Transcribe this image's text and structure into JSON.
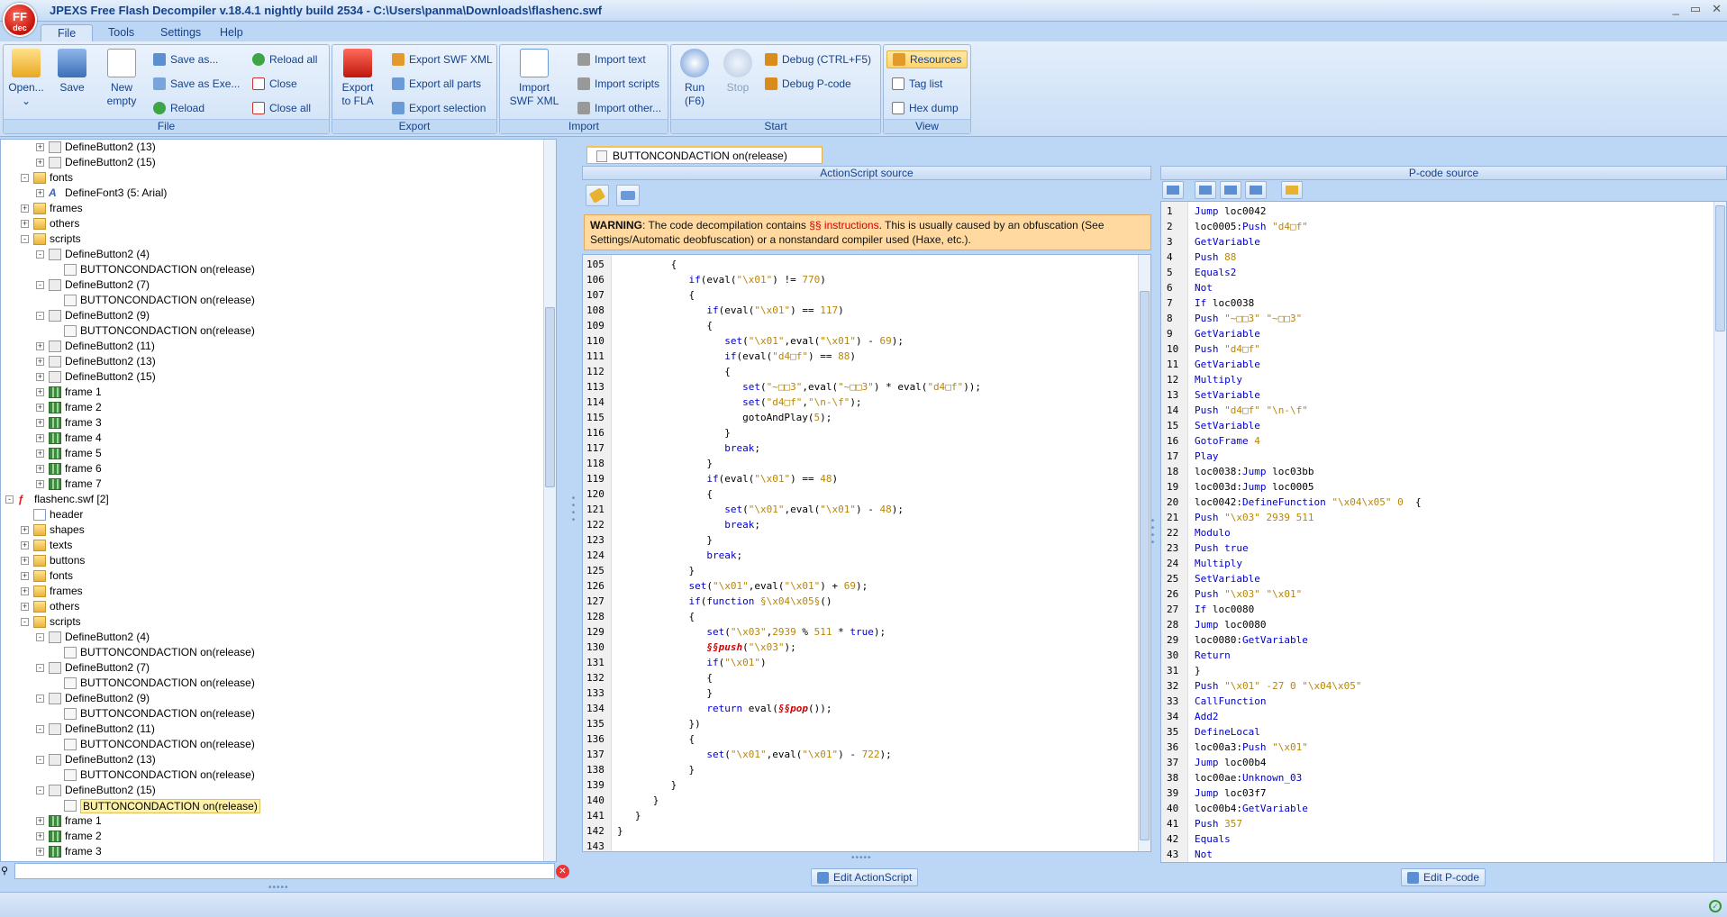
{
  "window": {
    "title": "JPEXS Free Flash Decompiler v.18.4.1 nightly build 2534 - C:\\Users\\panma\\Downloads\\flashenc.swf",
    "logo_top": "FF",
    "logo_bottom": "dec",
    "controls": [
      "_",
      "▭",
      "✕"
    ]
  },
  "menu_tabs": [
    "File",
    "Tools",
    "Settings",
    "Help"
  ],
  "ribbon": {
    "file": {
      "title": "File",
      "open": "Open...",
      "open_arrow": "⌄",
      "save": "Save",
      "new": "New",
      "new2": "empty",
      "save_as": "Save as...",
      "save_as_exe": "Save as Exe...",
      "reload": "Reload",
      "reload_all": "Reload all",
      "close": "Close",
      "close_all": "Close all"
    },
    "export": {
      "title": "Export",
      "export_fla": "Export",
      "export_fla2": "to FLA",
      "export_swf_xml": "Export SWF XML",
      "export_all_parts": "Export all parts",
      "export_selection": "Export selection"
    },
    "import": {
      "title": "Import",
      "import_swf_xml": "Import",
      "import_swf_xml2": "SWF XML",
      "import_text": "Import text",
      "import_scripts": "Import scripts",
      "import_other": "Import other..."
    },
    "start": {
      "title": "Start",
      "run": "Run",
      "run2": "(F6)",
      "stop": "Stop",
      "debug": "Debug (CTRL+F5)",
      "debug_pcode": "Debug P-code"
    },
    "view": {
      "title": "View",
      "resources": "Resources",
      "tag_list": "Tag list",
      "hex_dump": "Hex dump"
    }
  },
  "tree": [
    {
      "d": 1,
      "t": "DefineButton2 (13)",
      "i": "button",
      "e": "+"
    },
    {
      "d": 1,
      "t": "DefineButton2 (15)",
      "i": "button",
      "e": "+"
    },
    {
      "d": 0,
      "t": "fonts",
      "i": "folder",
      "e": "-"
    },
    {
      "d": 1,
      "t": "DefineFont3 (5: Arial)",
      "i": "font",
      "e": "+"
    },
    {
      "d": 0,
      "t": "frames",
      "i": "folder",
      "e": "+"
    },
    {
      "d": 0,
      "t": "others",
      "i": "folder",
      "e": "+"
    },
    {
      "d": 0,
      "t": "scripts",
      "i": "folder",
      "e": "-"
    },
    {
      "d": 1,
      "t": "DefineButton2 (4)",
      "i": "button",
      "e": "-"
    },
    {
      "d": 2,
      "t": "BUTTONCONDACTION on(release)",
      "i": "script",
      "e": ""
    },
    {
      "d": 1,
      "t": "DefineButton2 (7)",
      "i": "button",
      "e": "-"
    },
    {
      "d": 2,
      "t": "BUTTONCONDACTION on(release)",
      "i": "script",
      "e": ""
    },
    {
      "d": 1,
      "t": "DefineButton2 (9)",
      "i": "button",
      "e": "-"
    },
    {
      "d": 2,
      "t": "BUTTONCONDACTION on(release)",
      "i": "script",
      "e": ""
    },
    {
      "d": 1,
      "t": "DefineButton2 (11)",
      "i": "button",
      "e": "+"
    },
    {
      "d": 1,
      "t": "DefineButton2 (13)",
      "i": "button",
      "e": "+"
    },
    {
      "d": 1,
      "t": "DefineButton2 (15)",
      "i": "button",
      "e": "+"
    },
    {
      "d": 1,
      "t": "frame 1",
      "i": "frame",
      "e": "+"
    },
    {
      "d": 1,
      "t": "frame 2",
      "i": "frame",
      "e": "+"
    },
    {
      "d": 1,
      "t": "frame 3",
      "i": "frame",
      "e": "+"
    },
    {
      "d": 1,
      "t": "frame 4",
      "i": "frame",
      "e": "+"
    },
    {
      "d": 1,
      "t": "frame 5",
      "i": "frame",
      "e": "+"
    },
    {
      "d": 1,
      "t": "frame 6",
      "i": "frame",
      "e": "+"
    },
    {
      "d": 1,
      "t": "frame 7",
      "i": "frame",
      "e": "+"
    },
    {
      "d": -1,
      "t": "flashenc.swf [2]",
      "i": "swf",
      "e": "-"
    },
    {
      "d": 0,
      "t": "header",
      "i": "header",
      "e": ""
    },
    {
      "d": 0,
      "t": "shapes",
      "i": "folder",
      "e": "+"
    },
    {
      "d": 0,
      "t": "texts",
      "i": "folder",
      "e": "+"
    },
    {
      "d": 0,
      "t": "buttons",
      "i": "folder",
      "e": "+"
    },
    {
      "d": 0,
      "t": "fonts",
      "i": "folder",
      "e": "+"
    },
    {
      "d": 0,
      "t": "frames",
      "i": "folder",
      "e": "+"
    },
    {
      "d": 0,
      "t": "others",
      "i": "folder",
      "e": "+"
    },
    {
      "d": 0,
      "t": "scripts",
      "i": "folder",
      "e": "-"
    },
    {
      "d": 1,
      "t": "DefineButton2 (4)",
      "i": "button",
      "e": "-"
    },
    {
      "d": 2,
      "t": "BUTTONCONDACTION on(release)",
      "i": "script",
      "e": ""
    },
    {
      "d": 1,
      "t": "DefineButton2 (7)",
      "i": "button",
      "e": "-"
    },
    {
      "d": 2,
      "t": "BUTTONCONDACTION on(release)",
      "i": "script",
      "e": ""
    },
    {
      "d": 1,
      "t": "DefineButton2 (9)",
      "i": "button",
      "e": "-"
    },
    {
      "d": 2,
      "t": "BUTTONCONDACTION on(release)",
      "i": "script",
      "e": ""
    },
    {
      "d": 1,
      "t": "DefineButton2 (11)",
      "i": "button",
      "e": "-"
    },
    {
      "d": 2,
      "t": "BUTTONCONDACTION on(release)",
      "i": "script",
      "e": ""
    },
    {
      "d": 1,
      "t": "DefineButton2 (13)",
      "i": "button",
      "e": "-"
    },
    {
      "d": 2,
      "t": "BUTTONCONDACTION on(release)",
      "i": "script",
      "e": ""
    },
    {
      "d": 1,
      "t": "DefineButton2 (15)",
      "i": "button",
      "e": "-"
    },
    {
      "d": 2,
      "t": "BUTTONCONDACTION on(release)",
      "i": "script",
      "e": "",
      "sel": true
    },
    {
      "d": 1,
      "t": "frame 1",
      "i": "frame",
      "e": "+"
    },
    {
      "d": 1,
      "t": "frame 2",
      "i": "frame",
      "e": "+"
    },
    {
      "d": 1,
      "t": "frame 3",
      "i": "frame",
      "e": "+"
    }
  ],
  "search": {
    "value": "",
    "placeholder": ""
  },
  "doc_tab": "BUTTONCONDACTION on(release)",
  "as_header": "ActionScript source",
  "pcode_header": "P-code source",
  "warning": {
    "bold": "WARNING",
    "p1": ": The code decompilation contains ",
    "red": "§§ instructions",
    "p2": ". This is usually caused by an obfuscation (See",
    "line2": "Settings/Automatic deobfuscation) or a nonstandard compiler used (Haxe, etc.)."
  },
  "as_code": [
    {
      "n": "105",
      "c": "         {"
    },
    {
      "n": "106",
      "c": "            <k>if</k>(eval(<s>\"\\x01\"</s>) != <s>770</s>)"
    },
    {
      "n": "107",
      "c": "            {"
    },
    {
      "n": "108",
      "c": "               <k>if</k>(eval(<s>\"\\x01\"</s>) == <s>117</s>)"
    },
    {
      "n": "109",
      "c": "               {"
    },
    {
      "n": "110",
      "c": "                  <k>set</k>(<s>\"\\x01\"</s>,eval(<s>\"\\x01\"</s>) - <s>69</s>);"
    },
    {
      "n": "111",
      "c": "                  <k>if</k>(eval(<s>\"d4□f\"</s>) == <s>88</s>)"
    },
    {
      "n": "112",
      "c": "                  {"
    },
    {
      "n": "113",
      "c": "                     <k>set</k>(<s>\"~□□3\"</s>,eval(<s>\"~□□3\"</s>) * eval(<s>\"d4□f\"</s>));"
    },
    {
      "n": "114",
      "c": "                     <k>set</k>(<s>\"d4□f\"</s>,<s>\"\\n-\\f\"</s>);"
    },
    {
      "n": "115",
      "c": "                     gotoAndPlay(<s>5</s>);"
    },
    {
      "n": "116",
      "c": "                  }"
    },
    {
      "n": "117",
      "c": "                  <k>break</k>;"
    },
    {
      "n": "118",
      "c": "               }"
    },
    {
      "n": "119",
      "c": "               <k>if</k>(eval(<s>\"\\x01\"</s>) == <s>48</s>)"
    },
    {
      "n": "120",
      "c": "               {"
    },
    {
      "n": "121",
      "c": "                  <k>set</k>(<s>\"\\x01\"</s>,eval(<s>\"\\x01\"</s>) - <s>48</s>);"
    },
    {
      "n": "122",
      "c": "                  <k>break</k>;"
    },
    {
      "n": "123",
      "c": "               }"
    },
    {
      "n": "124",
      "c": "               <k>break</k>;"
    },
    {
      "n": "125",
      "c": "            }"
    },
    {
      "n": "126",
      "c": "            <k>set</k>(<s>\"\\x01\"</s>,eval(<s>\"\\x01\"</s>) + <s>69</s>);"
    },
    {
      "n": "127",
      "c": "            <k>if</k>(<k>function</k> <s>§\\x04\\x05§</s>()"
    },
    {
      "n": "128",
      "c": "            {"
    },
    {
      "n": "129",
      "c": "               <k>set</k>(<s>\"\\x03\"</s>,<s>2939</s> % <s>511</s> * <k>true</k>);"
    },
    {
      "n": "130",
      "c": "               <r>§§push</r>(<s>\"\\x03\"</s>);"
    },
    {
      "n": "131",
      "c": "               <k>if</k>(<s>\"\\x01\"</s>)"
    },
    {
      "n": "132",
      "c": "               {"
    },
    {
      "n": "133",
      "c": "               }"
    },
    {
      "n": "134",
      "c": "               <k>return</k> eval(<r>§§pop</r>());"
    },
    {
      "n": "135",
      "c": "            })"
    },
    {
      "n": "136",
      "c": "            {"
    },
    {
      "n": "137",
      "c": "               <k>set</k>(<s>\"\\x01\"</s>,eval(<s>\"\\x01\"</s>) - <s>722</s>);"
    },
    {
      "n": "138",
      "c": "            }"
    },
    {
      "n": "139",
      "c": "         }"
    },
    {
      "n": "140",
      "c": "      }"
    },
    {
      "n": "141",
      "c": "   }"
    },
    {
      "n": "142",
      "c": "}"
    },
    {
      "n": "143",
      "c": ""
    }
  ],
  "pcode": [
    "<k>Jump</k> loc0042",
    "loc0005:<k>Push</k> <s>\"d4□f\"</s>",
    "<k>GetVariable</k>",
    "<k>Push</k> <s>88</s>",
    "<k>Equals2</k>",
    "<k>Not</k>",
    "<k>If</k> loc0038",
    "<k>Push</k> <s>\"~□□3\" \"~□□3\"</s>",
    "<k>GetVariable</k>",
    "<k>Push</k> <s>\"d4□f\"</s>",
    "<k>GetVariable</k>",
    "<k>Multiply</k>",
    "<k>SetVariable</k>",
    "<k>Push</k> <s>\"d4□f\" \"\\n-\\f\"</s>",
    "<k>SetVariable</k>",
    "<k>GotoFrame</k> <s>4</s>",
    "<k>Play</k>",
    "loc0038:<k>Jump</k> loc03bb",
    "loc003d:<k>Jump</k> loc0005",
    "loc0042:<k>DefineFunction</k> <s>\"\\x04\\x05\" 0</s>  {",
    "<k>Push</k> <s>\"\\x03\" 2939 511</s>",
    "<k>Modulo</k>",
    "<k>Push</k> <k>true</k>",
    "<k>Multiply</k>",
    "<k>SetVariable</k>",
    "<k>Push</k> <s>\"\\x03\" \"\\x01\"</s>",
    "<k>If</k> loc0080",
    "<k>Jump</k> loc0080",
    "loc0080:<k>GetVariable</k>",
    "<k>Return</k>",
    "}",
    "<k>Push</k> <s>\"\\x01\" -27 0 \"\\x04\\x05\"</s>",
    "<k>CallFunction</k>",
    "<k>Add2</k>",
    "<k>DefineLocal</k>",
    "loc00a3:<k>Push</k> <s>\"\\x01\"</s>",
    "<k>Jump</k> loc00b4",
    "loc00ae:<k>Unknown_03</k>",
    "<k>Jump</k> loc03f7",
    "loc00b4:<k>GetVariable</k>",
    "<k>Push</k> <s>357</s>",
    "<k>Equals</k>",
    "<k>Not</k>"
  ],
  "buttons": {
    "edit_as": "Edit ActionScript",
    "edit_pcode": "Edit P-code"
  },
  "grip": "•••••",
  "vgrip": "•\n•\n•\n•",
  "colors": {
    "accent": "#15428b",
    "warning_bg": "#ffd9a0",
    "selected": "#fdf1a8"
  }
}
